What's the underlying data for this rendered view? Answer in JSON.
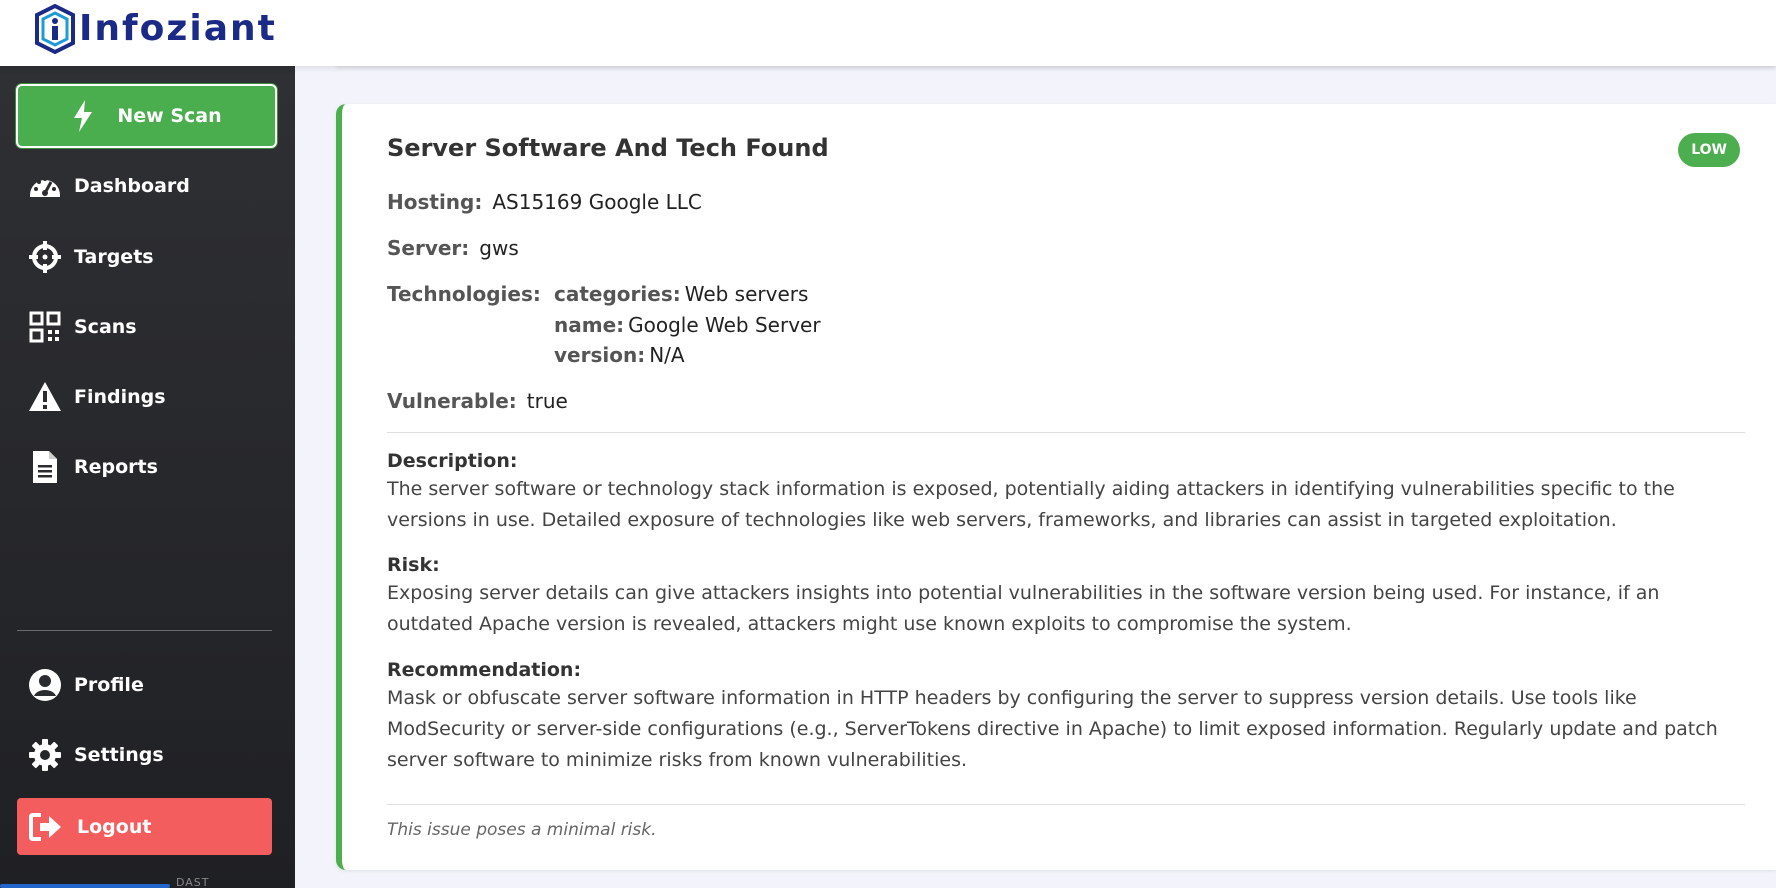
{
  "brand": {
    "name": "Infoziant"
  },
  "sidebar": {
    "new_scan": "New Scan",
    "items": [
      {
        "label": "Dashboard",
        "icon": "dashboard-icon"
      },
      {
        "label": "Targets",
        "icon": "crosshair-icon"
      },
      {
        "label": "Scans",
        "icon": "qr-code-icon"
      },
      {
        "label": "Findings",
        "icon": "warning-icon"
      },
      {
        "label": "Reports",
        "icon": "document-icon"
      }
    ],
    "bottom_items": [
      {
        "label": "Profile",
        "icon": "user-circle-icon"
      },
      {
        "label": "Settings",
        "icon": "gear-icon"
      }
    ],
    "logout": "Logout",
    "footer_text": "DAST"
  },
  "finding": {
    "title": "Server Software And Tech Found",
    "severity": "LOW",
    "hosting_label": "Hosting:",
    "hosting_value": "AS15169 Google LLC",
    "server_label": "Server:",
    "server_value": "gws",
    "technologies_label": "Technologies:",
    "technologies": {
      "categories_label": "categories:",
      "categories_value": "Web servers",
      "name_label": "name:",
      "name_value": "Google Web Server",
      "version_label": "version:",
      "version_value": "N/A"
    },
    "vulnerable_label": "Vulnerable:",
    "vulnerable_value": "true",
    "description_label": "Description:",
    "description": "The server software or technology stack information is exposed, potentially aiding attackers in identifying vulnerabilities specific to the versions in use. Detailed exposure of technologies like web servers, frameworks, and libraries can assist in targeted exploitation.",
    "risk_label": "Risk:",
    "risk": "Exposing server details can give attackers insights into potential vulnerabilities in the software version being used. For instance, if an outdated Apache version is revealed, attackers might use known exploits to compromise the system.",
    "recommendation_label": "Recommendation:",
    "recommendation": "Mask or obfuscate server software information in HTTP headers by configuring the server to suppress version details. Use tools like ModSecurity or server-side configurations (e.g., ServerTokens directive in Apache) to limit exposed information. Regularly update and patch server software to minimize risks from known vulnerabilities.",
    "footer_note": "This issue poses a minimal risk."
  },
  "colors": {
    "accent_green": "#4cae4f",
    "logout_red": "#f45d5d",
    "brand_navy": "#1b2a86"
  }
}
